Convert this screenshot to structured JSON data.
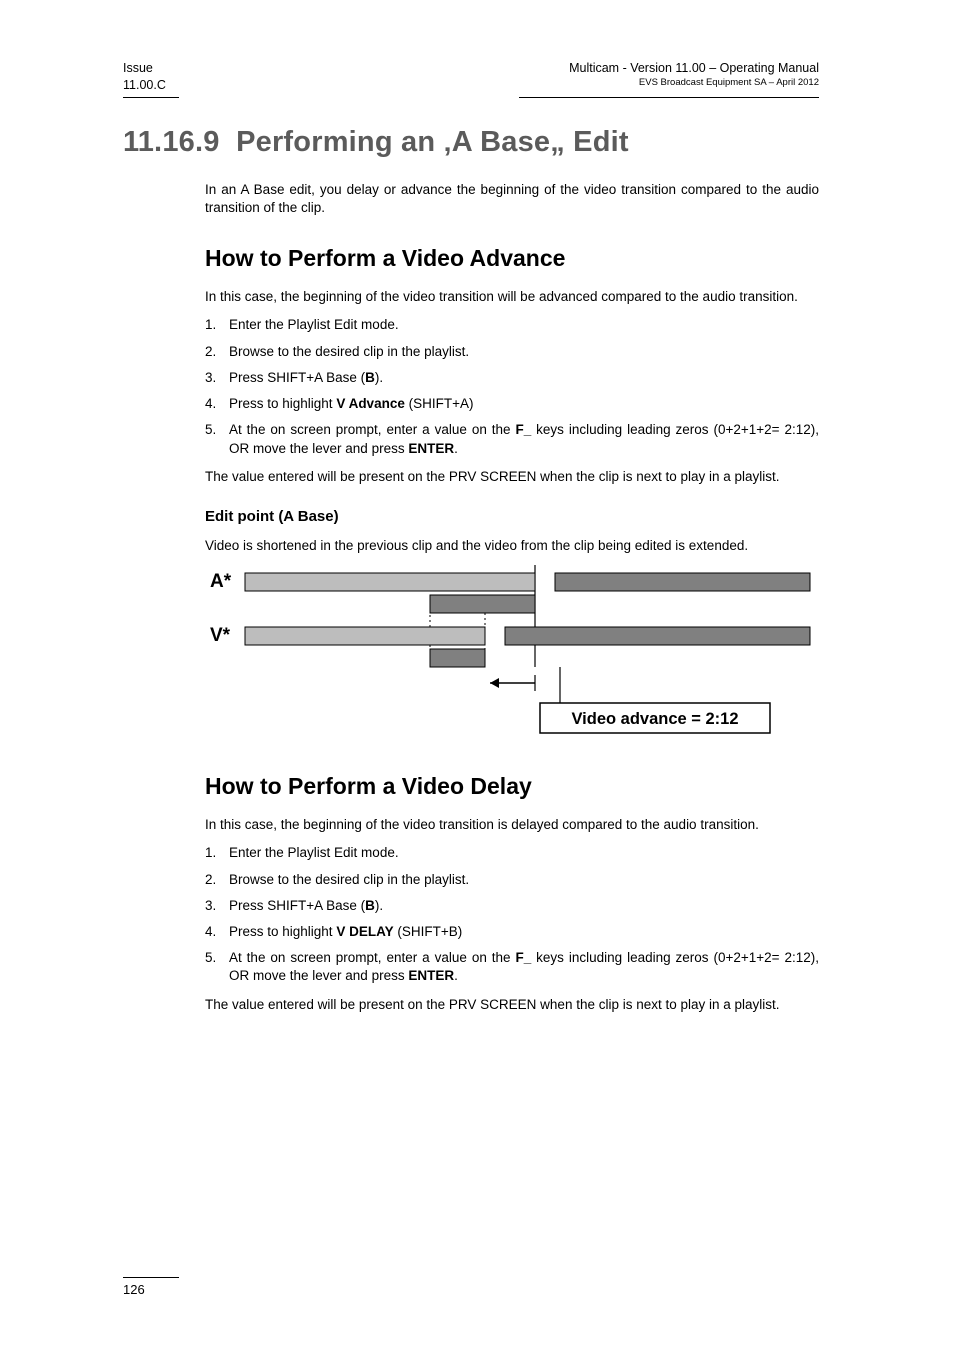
{
  "header": {
    "left_line1": "Issue",
    "left_line2": "11.00.C",
    "right_line1": "Multicam - Version 11.00 – Operating Manual",
    "right_line2": "EVS Broadcast Equipment SA – April 2012"
  },
  "section": {
    "number": "11.16.9",
    "title": "Performing an ‚A Base„ Edit"
  },
  "intro": "In an A Base edit, you delay or advance the beginning of the video transition compared to the audio transition of the clip.",
  "advance": {
    "heading": "How to Perform a Video Advance",
    "intro": "In this case, the beginning of the video transition will be advanced compared to the audio transition.",
    "steps": [
      {
        "n": "1.",
        "pre": "Enter the Playlist Edit mode."
      },
      {
        "n": "2.",
        "pre": "Browse to the desired clip in the playlist."
      },
      {
        "n": "3.",
        "pre": "Press SHIFT+A Base (",
        "bold": "B",
        "post": ")."
      },
      {
        "n": "4.",
        "pre": "Press to highlight ",
        "bold": "V Advance",
        "post": " (SHIFT+A)"
      },
      {
        "n": "5.",
        "pre": "At the on screen prompt, enter a value on the ",
        "bold": "F_",
        "post": " keys including leading zeros (0+2+1+2= 2:12), OR move the lever and press ",
        "bold2": "ENTER",
        "post2": "."
      }
    ],
    "outro": "The value entered will be present on the PRV SCREEN when the clip is next to play in a playlist.",
    "editpoint_heading": "Edit point (A Base)",
    "editpoint_text": "Video is shortened in the previous clip and the video from the clip being edited is extended.",
    "diagram": {
      "a_label": "A*",
      "v_label": "V*",
      "caption": "Video advance = 2:12"
    }
  },
  "delay": {
    "heading": "How to Perform a Video Delay",
    "intro": "In this case, the beginning of the video transition is delayed compared to the audio transition.",
    "steps": [
      {
        "n": "1.",
        "pre": "Enter the Playlist Edit mode."
      },
      {
        "n": "2.",
        "pre": "Browse to the desired clip in the playlist."
      },
      {
        "n": "3.",
        "pre": "Press SHIFT+A Base (",
        "bold": "B",
        "post": ")."
      },
      {
        "n": "4.",
        "pre": "Press to highlight ",
        "bold": "V DELAY",
        "post": " (SHIFT+B)"
      },
      {
        "n": "5.",
        "pre": "At the on screen prompt, enter a value on the ",
        "bold": "F_",
        "post": " keys including leading zeros (0+2+1+2= 2:12), OR move the lever and press ",
        "bold2": "ENTER",
        "post2": "."
      }
    ],
    "outro": "The value entered will be present on the PRV SCREEN when the clip is next to play in a playlist."
  },
  "page_number": "126"
}
